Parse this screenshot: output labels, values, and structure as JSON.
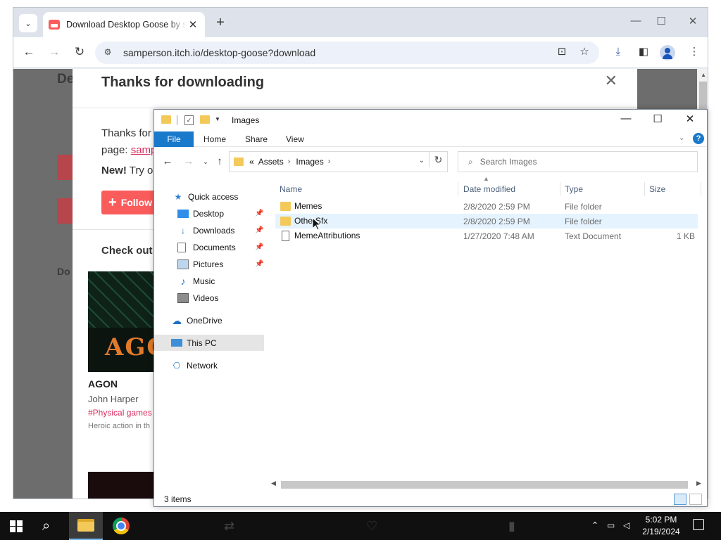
{
  "browser": {
    "tab_title": "Download Desktop Goose by sa",
    "url": "samperson.itch.io/desktop-goose?download"
  },
  "page": {
    "bg_heading": "De",
    "bg_label": "Do",
    "modal": {
      "title": "Thanks for downloading",
      "text_line1": "Thanks for",
      "text_line2_prefix": "page: ",
      "text_link": "samp",
      "new_bold": "New!",
      "new_rest": " Try o",
      "follow_label": "Follow",
      "check_out": "Check out",
      "game": {
        "thumb_word": "AGON",
        "title": "AGON",
        "author": "John Harper",
        "tag": "#Physical games",
        "desc": "Heroic action in th"
      }
    }
  },
  "explorer": {
    "title": "Images",
    "ribbon_tabs": [
      "File",
      "Home",
      "Share",
      "View"
    ],
    "help": "?",
    "address": {
      "prefix": "«",
      "segments": [
        "Assets",
        "Images"
      ]
    },
    "search_placeholder": "Search Images",
    "nav": {
      "quick_access": "Quick access",
      "desktop": "Desktop",
      "downloads": "Downloads",
      "documents": "Documents",
      "pictures": "Pictures",
      "music": "Music",
      "videos": "Videos",
      "onedrive": "OneDrive",
      "this_pc": "This PC",
      "network": "Network"
    },
    "columns": {
      "name": "Name",
      "date": "Date modified",
      "type": "Type",
      "size": "Size"
    },
    "files": [
      {
        "name": "Memes",
        "date": "2/8/2020 2:59 PM",
        "type": "File folder",
        "size": ""
      },
      {
        "name": "OtherSfx",
        "date": "2/8/2020 2:59 PM",
        "type": "File folder",
        "size": ""
      },
      {
        "name": "MemeAttributions",
        "date": "1/27/2020 7:48 AM",
        "type": "Text Document",
        "size": "1 KB"
      }
    ],
    "status": "3 items"
  },
  "taskbar": {
    "time": "5:02 PM",
    "date": "2/19/2024"
  },
  "colors": {
    "itch_red": "#fa5c5c",
    "link_pink": "#da2c5e",
    "explorer_blue": "#1979ca",
    "folder_yellow": "#f3ca5a",
    "selection": "#cce4f7"
  }
}
